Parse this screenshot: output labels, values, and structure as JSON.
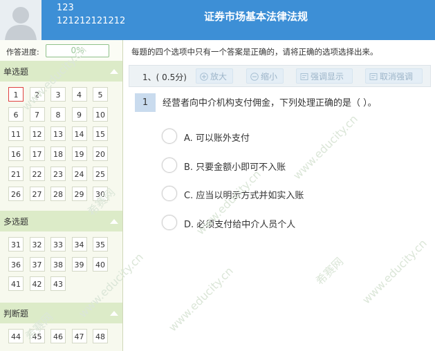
{
  "header": {
    "user_name": "123",
    "user_id": "121212121212",
    "exam_title": "证券市场基本法律法规"
  },
  "sidebar": {
    "progress_label": "作答进度:",
    "progress_value": "0%",
    "progress_fraction": 0,
    "current_question": 1,
    "sections": [
      {
        "title": "单选题",
        "numbers": [
          "1",
          "2",
          "3",
          "4",
          "5",
          "6",
          "7",
          "8",
          "9",
          "10",
          "11",
          "12",
          "13",
          "14",
          "15",
          "16",
          "17",
          "18",
          "19",
          "20",
          "21",
          "22",
          "23",
          "24",
          "25",
          "26",
          "27",
          "28",
          "29",
          "30"
        ]
      },
      {
        "title": "多选题",
        "numbers": [
          "31",
          "32",
          "33",
          "34",
          "35",
          "36",
          "37",
          "38",
          "39",
          "40",
          "41",
          "42",
          "43"
        ]
      },
      {
        "title": "判断题",
        "numbers": [
          "44",
          "45",
          "46",
          "47",
          "48"
        ]
      }
    ]
  },
  "main": {
    "instruction": "每题的四个选项中只有一个答案是正确的，请将正确的选项选择出来。",
    "toolbar": {
      "score_label": "1、( 0.5分)",
      "zoom_in_label": "放大",
      "zoom_out_label": "缩小",
      "highlight_label": "强调显示",
      "cancel_highlight_label": "取消强调"
    },
    "question": {
      "number": "1",
      "stem": "经营者向中介机构支付佣金，下列处理正确的是（ ）。",
      "options": [
        "A. 可以账外支付",
        "B. 只要金额小即可不入账",
        "C. 应当以明示方式并如实入账",
        "D. 必须支付给中介人员个人"
      ]
    }
  },
  "watermark": {
    "text_cn": "希赛网",
    "text_en": "www.educity.cn"
  },
  "colors": {
    "header_bg": "#3d8fd6",
    "sidebar_bg": "#f7f9ee",
    "section_bg": "#dcebc8",
    "current_border": "#e04040",
    "toolbar_bg": "#edf2f5"
  }
}
